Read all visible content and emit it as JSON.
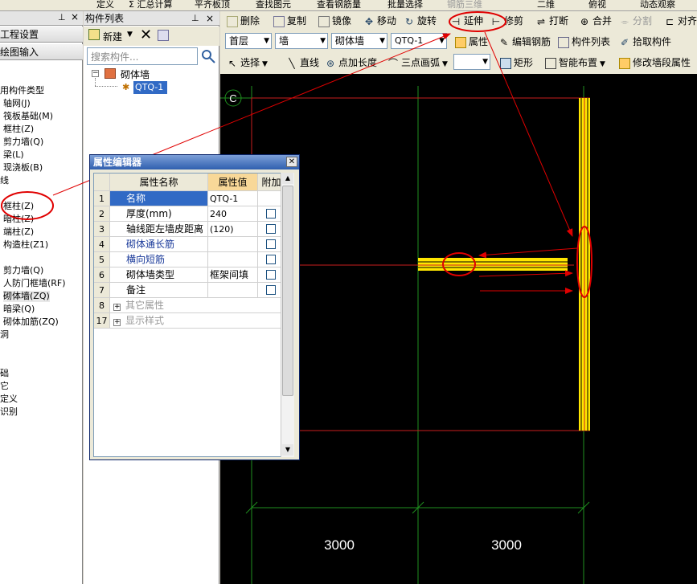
{
  "top_strip": [
    "定义",
    "Σ 汇总计算",
    "平齐板顶",
    "查找图元",
    "查看钢筋量",
    "批量选择",
    "钢筋三维",
    "二维",
    "俯视",
    "动态观察"
  ],
  "left_panel": {
    "project_settings": "工程设置",
    "drawing_input": "绘图输入",
    "items": [
      "用构件类型",
      "轴网(J)",
      "筏板基础(M)",
      "框柱(Z)",
      "剪力墙(Q)",
      "梁(L)",
      "现浇板(B)",
      "线",
      "框柱(Z)",
      "暗柱(Z)",
      "端柱(Z)",
      "构造柱(Z1)",
      "剪力墙(Q)",
      "人防门框墙(RF)",
      "砌体墙(ZQ)",
      "暗梁(Q)",
      "砌体加筋(ZQ)",
      "洞",
      "础",
      "它",
      "定义",
      "识别"
    ]
  },
  "component_list": {
    "title": "构件列表",
    "new_label": "新建",
    "search_placeholder": "搜索构件...",
    "tree_root": "砌体墙",
    "tree_child": "QTQ-1"
  },
  "toolbar": {
    "row1": [
      "删除",
      "复制",
      "镜像",
      "移动",
      "旋转",
      "延伸",
      "修剪",
      "打断",
      "合并",
      "分割",
      "对齐"
    ],
    "floor": "首层",
    "category": "墙",
    "type": "砌体墙",
    "component": "QTQ-1",
    "row2": [
      "属性",
      "编辑钢筋",
      "构件列表",
      "拾取构件"
    ],
    "row3": [
      "选择",
      "直线",
      "点加长度",
      "三点画弧",
      "矩形",
      "智能布置",
      "修改墙段属性"
    ]
  },
  "property_editor": {
    "title": "属性编辑器",
    "headers": [
      "属性名称",
      "属性值",
      "附加"
    ],
    "rows": [
      {
        "num": "1",
        "name": "名称",
        "value": "QTQ-1",
        "check": false
      },
      {
        "num": "2",
        "name": "厚度(mm)",
        "value": "240",
        "check": true
      },
      {
        "num": "3",
        "name": "轴线距左墙皮距离",
        "value": "(120)",
        "check": true
      },
      {
        "num": "4",
        "name": "砌体通长筋",
        "value": "",
        "check": true
      },
      {
        "num": "5",
        "name": "横向短筋",
        "value": "",
        "check": true
      },
      {
        "num": "6",
        "name": "砌体墙类型",
        "value": "框架间填",
        "check": true
      },
      {
        "num": "7",
        "name": "备注",
        "value": "",
        "check": true
      },
      {
        "num": "8",
        "name": "其它属性",
        "value": "",
        "check": false
      },
      {
        "num": "17",
        "name": "显示样式",
        "value": "",
        "check": false
      }
    ]
  },
  "canvas": {
    "axis_label": "C",
    "dim1": "3000",
    "dim2": "3000"
  }
}
